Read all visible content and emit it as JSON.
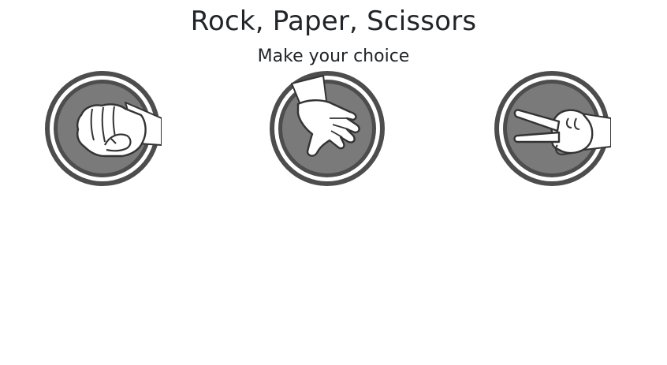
{
  "page": {
    "title": "Rock, Paper, Scissors",
    "subtitle": "Make your choice"
  },
  "choices": [
    {
      "id": "rock",
      "icon": "rock-fist-icon"
    },
    {
      "id": "paper",
      "icon": "paper-hand-icon"
    },
    {
      "id": "scissors",
      "icon": "scissors-hand-icon"
    }
  ],
  "colors": {
    "ring": "#4d4d4d",
    "disc": "#7a7a7a",
    "hand_fill": "#ffffff",
    "hand_stroke": "#333333"
  }
}
